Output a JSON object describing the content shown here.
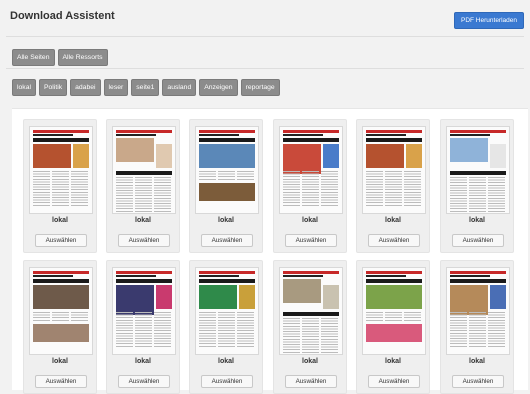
{
  "header": {
    "title": "Download Assistent",
    "download_label": "PDF Herunterladen"
  },
  "scope_buttons": [
    {
      "label": "Alle Seiten"
    },
    {
      "label": "Alle Ressorts"
    }
  ],
  "ressort_buttons": [
    {
      "label": "lokal"
    },
    {
      "label": "Politik"
    },
    {
      "label": "adabei"
    },
    {
      "label": "leser"
    },
    {
      "label": "seite1"
    },
    {
      "label": "ausland"
    },
    {
      "label": "Anzeigen"
    },
    {
      "label": "reportage"
    }
  ],
  "pages": [
    {
      "label": "lokal",
      "button": "Auswählen",
      "img": "#b5522f",
      "img2": "#d9a24a"
    },
    {
      "label": "lokal",
      "button": "Auswählen",
      "img": "#c9a88a",
      "img2": "#e0c9b0"
    },
    {
      "label": "lokal",
      "button": "Auswählen",
      "img": "#5b88b8",
      "img2": "#7c5c3a"
    },
    {
      "label": "lokal",
      "button": "Auswählen",
      "img": "#c94a3a",
      "img2": "#4a7cc9"
    },
    {
      "label": "lokal",
      "button": "Auswählen",
      "img": "#b5522f",
      "img2": "#d9a24a"
    },
    {
      "label": "lokal",
      "button": "Auswählen",
      "img": "#8fb3d9",
      "img2": "#e6e6e6"
    },
    {
      "label": "lokal",
      "button": "Auswählen",
      "img": "#6e5a4a",
      "img2": "#a08470"
    },
    {
      "label": "lokal",
      "button": "Auswählen",
      "img": "#3a3a6e",
      "img2": "#c93a6e"
    },
    {
      "label": "lokal",
      "button": "Auswählen",
      "img": "#2f8a4a",
      "img2": "#c9a03a"
    },
    {
      "label": "lokal",
      "button": "Auswählen",
      "img": "#a89a80",
      "img2": "#c9c2b0"
    },
    {
      "label": "lokal",
      "button": "Auswählen",
      "img": "#7ca34a",
      "img2": "#d95a7c"
    },
    {
      "label": "lokal",
      "button": "Auswählen",
      "img": "#b58a5a",
      "img2": "#4a6eb5"
    }
  ]
}
